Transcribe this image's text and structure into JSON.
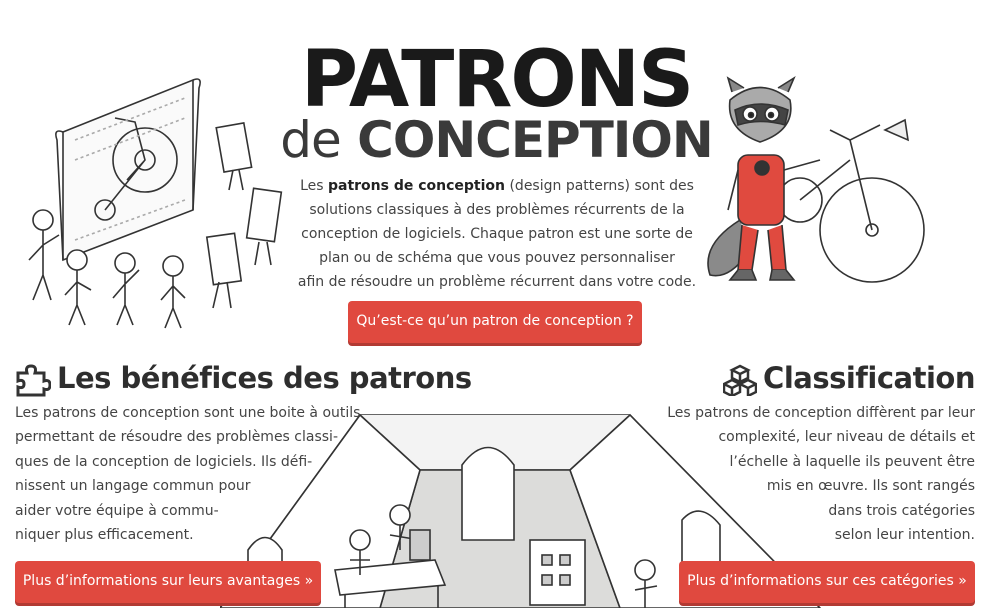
{
  "header": {
    "title_line1": "PATRONS",
    "title_de": "de",
    "title_conception": "CONCEPTION"
  },
  "intro": {
    "prefix": "Les ",
    "bold": "patrons de conception",
    "lines_after_bold": " (design patterns) sont des",
    "line2": "solutions classiques à des problèmes récurrents de la",
    "line3": "conception de logiciels. Chaque patron est une sorte de",
    "line4": "plan ou de schéma que vous pouvez personnaliser",
    "line5": "afin de résoudre un problème récurrent dans votre code."
  },
  "cta": {
    "what_label": "Qu’est-ce qu’un patron de conception ?"
  },
  "benefits": {
    "icon": "puzzle-icon",
    "title": "Les bénéfices des patrons",
    "lines": [
      "Les patrons de conception sont une boite à outils",
      "permettant de résoudre des problèmes classi-",
      "ques de la conception de logiciels. Ils défi-",
      "nissent un langage commun pour",
      "aider votre équipe à commu-",
      "niquer plus efficacement."
    ],
    "button_label": "Plus d’informations sur leurs avantages »"
  },
  "classification": {
    "icon": "cubes-icon",
    "title": "Classification",
    "lines": [
      "Les patrons de conception diffèrent par leur",
      "complexité, leur niveau de détails et",
      "l’échelle à laquelle ils peuvent être",
      "mis en œuvre. Ils sont rangés",
      "dans trois catégories",
      "selon leur intention."
    ],
    "button_label": "Plus d’informations sur ces catégories »"
  },
  "colors": {
    "accent": "#e0493f",
    "accent_shadow": "#b23a33",
    "text": "#444444",
    "title": "#1a1a1a"
  }
}
